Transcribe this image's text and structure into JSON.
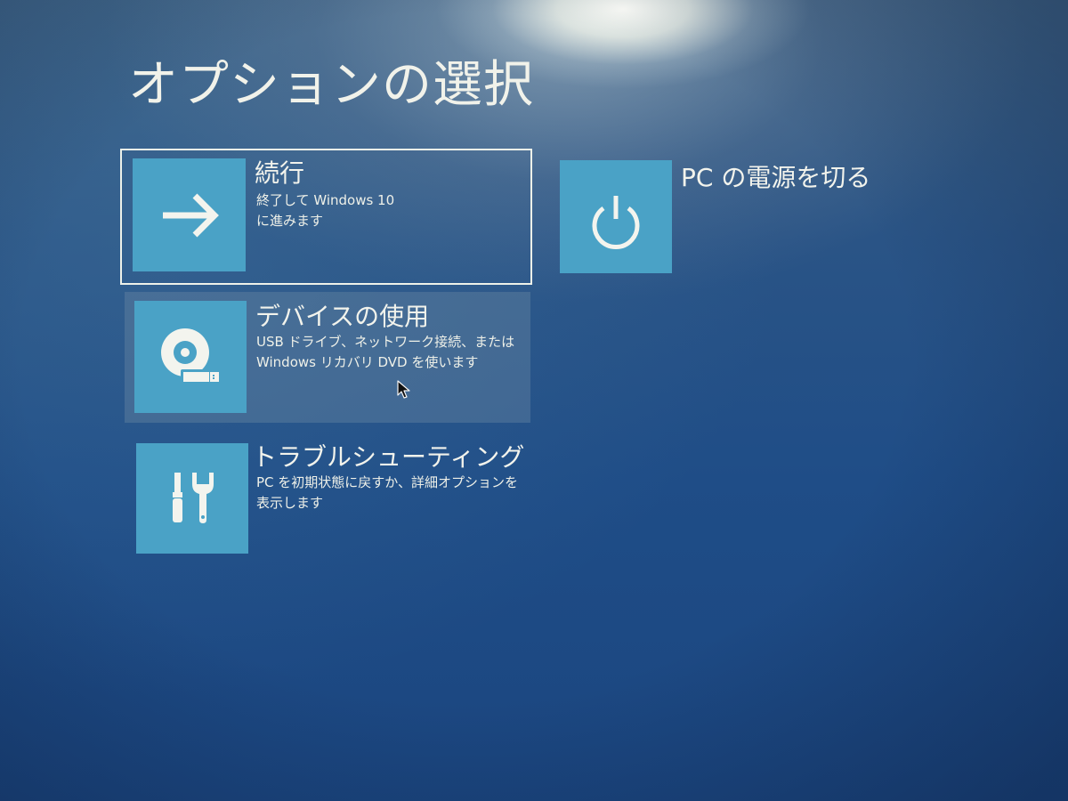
{
  "screen": {
    "title": "オプションの選択"
  },
  "options": {
    "continue": {
      "heading": "続行",
      "desc_line1": "終了して Windows 10",
      "desc_line2": "に進みます",
      "icon": "arrow-right-icon",
      "selected": true
    },
    "device": {
      "heading": "デバイスの使用",
      "desc_line1": "USB ドライブ、ネットワーク接続、または",
      "desc_line2": "Windows リカバリ DVD を使います",
      "icon": "disc-drive-icon",
      "hovered": true
    },
    "troubleshoot": {
      "heading": "トラブルシューティング",
      "desc_line1": "PC を初期状態に戻すか、詳細オプションを",
      "desc_line2": "表示します",
      "icon": "tools-icon"
    },
    "power": {
      "heading": "PC の電源を切る",
      "icon": "power-icon"
    }
  },
  "colors": {
    "background": "#1f4d87",
    "tile": "#4aa2c6",
    "text": "#f2f3ec",
    "selection_border": "#eef1e9"
  }
}
